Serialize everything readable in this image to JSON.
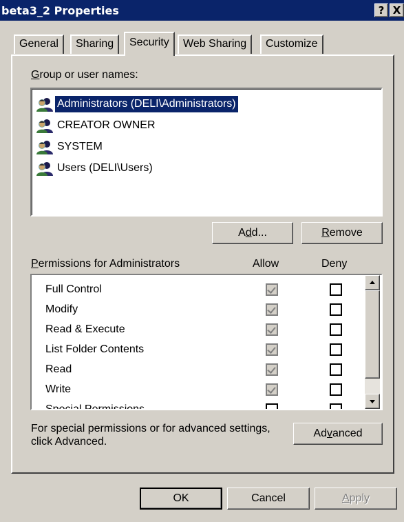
{
  "window": {
    "title": "beta3_2 Properties",
    "help_label": "?",
    "close_label": "X"
  },
  "tabs": [
    {
      "label": "General"
    },
    {
      "label": "Sharing"
    },
    {
      "label": "Security",
      "active": true
    },
    {
      "label": "Web Sharing"
    },
    {
      "label": "Customize"
    }
  ],
  "groups": {
    "label_accel": "G",
    "label_rest": "roup or user names:",
    "items": [
      {
        "label": "Administrators (DELI\\Administrators)",
        "icon": "user-group-icon",
        "selected": true
      },
      {
        "label": "CREATOR OWNER",
        "icon": "user-group-icon"
      },
      {
        "label": "SYSTEM",
        "icon": "user-group-icon"
      },
      {
        "label": "Users (DELI\\Users)",
        "icon": "user-group-icon"
      }
    ]
  },
  "buttons": {
    "add_pre": "A",
    "add_accel": "d",
    "add_post": "d...",
    "remove_accel": "R",
    "remove_rest": "emove",
    "advanced_pre": "Ad",
    "advanced_accel": "v",
    "advanced_post": "anced",
    "ok": "OK",
    "cancel": "Cancel",
    "apply_accel": "A",
    "apply_rest": "pply"
  },
  "permissions": {
    "label_accel": "P",
    "label_rest": "ermissions for Administrators",
    "allow_header": "Allow",
    "deny_header": "Deny",
    "rows": [
      {
        "name": "Full Control",
        "allow": true,
        "deny": false
      },
      {
        "name": "Modify",
        "allow": true,
        "deny": false
      },
      {
        "name": "Read & Execute",
        "allow": true,
        "deny": false
      },
      {
        "name": "List Folder Contents",
        "allow": true,
        "deny": false
      },
      {
        "name": "Read",
        "allow": true,
        "deny": false
      },
      {
        "name": "Write",
        "allow": true,
        "deny": false
      },
      {
        "name": "Special Permissions",
        "allow": false,
        "deny": false
      }
    ]
  },
  "advanced_note": {
    "line1": "For special permissions or for advanced settings,",
    "line2": "click Advanced."
  },
  "colors": {
    "face": "#d4d0c8",
    "titlebar": "#0a246a",
    "selection": "#0a246a"
  }
}
